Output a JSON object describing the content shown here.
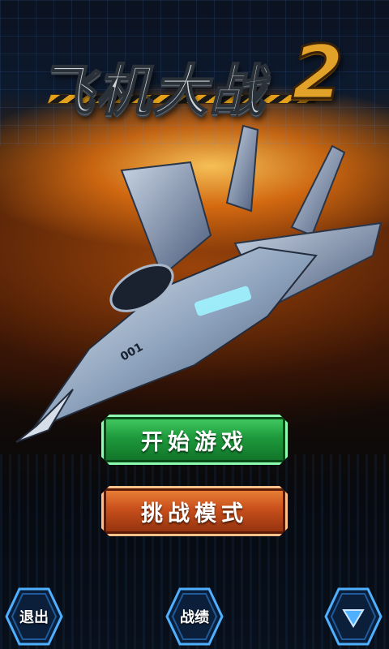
{
  "title": {
    "text": "飞机大战",
    "number": "2"
  },
  "menu": {
    "start_label": "开始游戏",
    "challenge_label": "挑战模式"
  },
  "footer": {
    "exit_label": "退出",
    "records_label": "战绩",
    "more_icon": "chevron-down-icon"
  },
  "jet": {
    "tail_number": "001"
  },
  "colors": {
    "start_button": "#1e9a3c",
    "challenge_button": "#c9501c",
    "hex_border": "#4fb0ff",
    "title_accent": "#e2a22a"
  }
}
